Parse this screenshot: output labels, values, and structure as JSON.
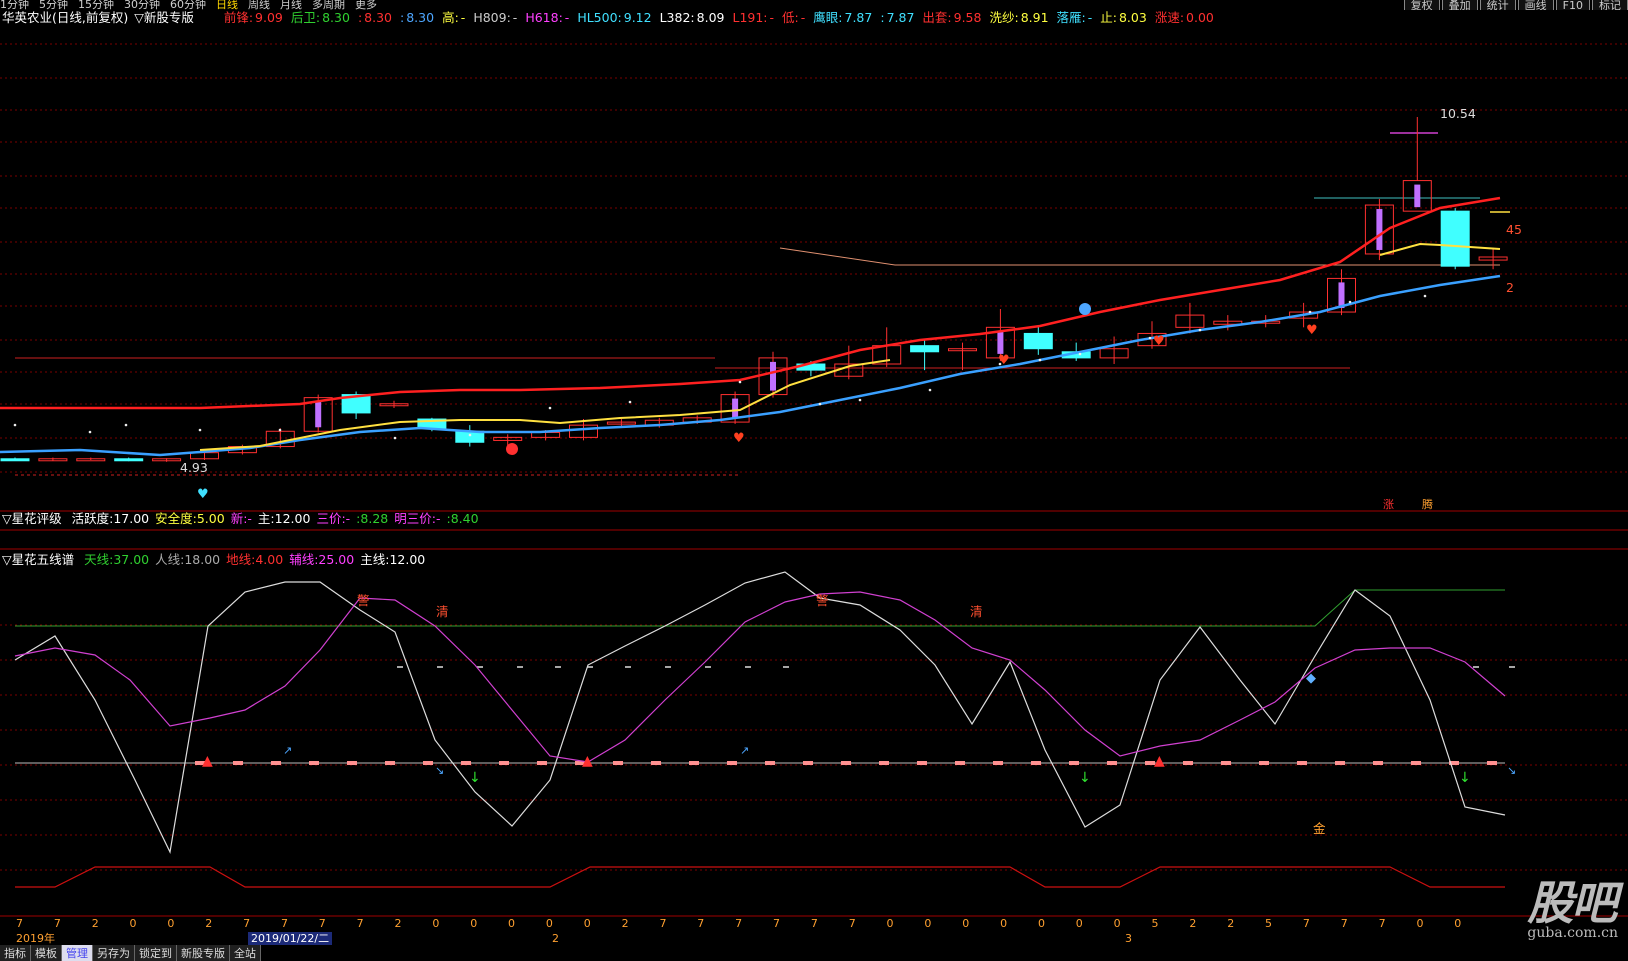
{
  "topbar": {
    "tabs": [
      "1分钟",
      "5分钟",
      "15分钟",
      "30分钟",
      "60分钟",
      "日线",
      "周线",
      "月线",
      "多周期",
      "更多"
    ],
    "active_tab": "日线",
    "buttons": [
      "复权",
      "叠加",
      "统计",
      "画线",
      "F10",
      "标记"
    ]
  },
  "header": {
    "title": "华英农业(日线,前复权)",
    "template": "▽新股专版",
    "items": [
      {
        "label": "前锋:",
        "value": "9.09",
        "color": "#ff3030"
      },
      {
        "label": "后卫:",
        "value": "8.30",
        "color": "#30d030"
      },
      {
        "label": ":",
        "value": "8.30",
        "color": "#ff3030"
      },
      {
        "label": ":",
        "value": "8.30",
        "color": "#4da6ff"
      },
      {
        "label": "高:",
        "value": "-",
        "color": "#ffff40"
      },
      {
        "label": "H809:",
        "value": "-",
        "color": "#cccccc"
      },
      {
        "label": "H618:",
        "value": "-",
        "color": "#ff40ff"
      },
      {
        "label": "HL500:",
        "value": "9.12",
        "color": "#40e0ff"
      },
      {
        "label": "L382:",
        "value": "8.09",
        "color": "#ffffff"
      },
      {
        "label": "L191:",
        "value": "-",
        "color": "#ff3030"
      },
      {
        "label": "低:",
        "value": "-",
        "color": "#ff3030"
      },
      {
        "label": "鹰眼:",
        "value": "7.87",
        "color": "#40e0ff"
      },
      {
        "label": ":",
        "value": "7.87",
        "color": "#40e0ff"
      },
      {
        "label": "出套:",
        "value": "9.58",
        "color": "#ff3030"
      },
      {
        "label": "洗纱:",
        "value": "8.91",
        "color": "#ffff40"
      },
      {
        "label": "落雁:",
        "value": "-",
        "color": "#40e0ff"
      },
      {
        "label": "止:",
        "value": "8.03",
        "color": "#ffff40"
      },
      {
        "label": "涨速:",
        "value": "0.00",
        "color": "#ff3030"
      }
    ]
  },
  "price_labels": {
    "high": "10.54",
    "low": "4.93",
    "right_top": "45",
    "right_bottom": "2"
  },
  "price_markers": {
    "zhang": "涨",
    "teng": "腾"
  },
  "ind1": {
    "title": "▽星花评级",
    "items": [
      {
        "label": "活跃度:",
        "value": "17.00",
        "color": "#ffffff"
      },
      {
        "label": "安全度:",
        "value": "5.00",
        "color": "#ffff40"
      },
      {
        "label": "新:",
        "value": "-",
        "color": "#ff40ff"
      },
      {
        "label": "主:",
        "value": "12.00",
        "color": "#ffffff"
      },
      {
        "label": "三价:",
        "value": "-",
        "color": "#ff40ff"
      },
      {
        "label": ":",
        "value": "8.28",
        "color": "#30d030"
      },
      {
        "label": "明三价:",
        "value": "-",
        "color": "#ff40ff"
      },
      {
        "label": ":",
        "value": "8.40",
        "color": "#30d030"
      }
    ]
  },
  "ind2": {
    "title": "▽星花五线谱",
    "items": [
      {
        "label": "天线:",
        "value": "37.00",
        "color": "#30d030"
      },
      {
        "label": "人线:",
        "value": "18.00",
        "color": "#aaaaaa"
      },
      {
        "label": "地线:",
        "value": "4.00",
        "color": "#ff3030"
      },
      {
        "label": "辅线:",
        "value": "25.00",
        "color": "#ff40ff"
      },
      {
        "label": "主线:",
        "value": "12.00",
        "color": "#ffffff"
      }
    ],
    "signals": {
      "jing": "警",
      "qing": "清",
      "jin": "金"
    }
  },
  "xaxis_values": [
    "7",
    "7",
    "2",
    "0",
    "0",
    "2",
    "7",
    "7",
    "7",
    "7",
    "2",
    "0",
    "0",
    "0",
    "0",
    "0",
    "2",
    "7",
    "7",
    "7",
    "7",
    "7",
    "7",
    "0",
    "0",
    "0",
    "0",
    "0",
    "0",
    "0",
    "5",
    "2",
    "2",
    "5",
    "7",
    "7",
    "7",
    "0",
    "0"
  ],
  "statusbar": {
    "year": "2019年",
    "date": "2019/01/22/二",
    "month2": "2",
    "month3": "3",
    "tabs": [
      "指标",
      "模板",
      "管理",
      "另存为",
      "锁定到",
      "新股专版",
      "全站"
    ],
    "active_tab": "管理"
  },
  "watermark": {
    "big": "股吧",
    "small": "guba.com.cn"
  },
  "colors": {
    "up": "#ff3030",
    "down": "#40ffff",
    "ma_red": "#ff2020",
    "ma_blue": "#3aa0ff",
    "ma_yellow": "#ffe040",
    "grid": "#7a0000"
  },
  "chart_data": {
    "type": "candlestick",
    "candles": [
      [
        4.95,
        4.93,
        4.97,
        4.92
      ],
      [
        4.94,
        4.95,
        4.97,
        4.92
      ],
      [
        4.95,
        4.95,
        4.97,
        4.93
      ],
      [
        4.95,
        4.92,
        4.97,
        4.91
      ],
      [
        4.92,
        4.95,
        4.96,
        4.9
      ],
      [
        4.95,
        5.05,
        5.07,
        4.93
      ],
      [
        5.05,
        5.15,
        5.18,
        5.02
      ],
      [
        5.15,
        5.4,
        5.45,
        5.12
      ],
      [
        5.4,
        5.95,
        6.0,
        5.38
      ],
      [
        6.0,
        5.7,
        6.05,
        5.6
      ],
      [
        5.85,
        5.85,
        5.9,
        5.78
      ],
      [
        5.6,
        5.45,
        5.62,
        5.4
      ],
      [
        5.4,
        5.22,
        5.5,
        5.15
      ],
      [
        5.25,
        5.3,
        5.35,
        5.1
      ],
      [
        5.3,
        5.38,
        5.42,
        5.25
      ],
      [
        5.3,
        5.5,
        5.6,
        5.25
      ],
      [
        5.55,
        5.55,
        5.6,
        5.48
      ],
      [
        5.5,
        5.58,
        5.62,
        5.46
      ],
      [
        5.55,
        5.62,
        5.66,
        5.52
      ],
      [
        5.55,
        6.0,
        6.05,
        5.52
      ],
      [
        6.0,
        6.6,
        6.7,
        5.95
      ],
      [
        6.5,
        6.4,
        6.55,
        6.3
      ],
      [
        6.3,
        6.5,
        6.8,
        6.25
      ],
      [
        6.5,
        6.8,
        7.1,
        6.45
      ],
      [
        6.8,
        6.7,
        6.9,
        6.4
      ],
      [
        6.75,
        6.75,
        6.85,
        6.4
      ],
      [
        6.6,
        7.1,
        7.4,
        6.55
      ],
      [
        7.0,
        6.75,
        7.1,
        6.65
      ],
      [
        6.7,
        6.6,
        6.85,
        6.55
      ],
      [
        6.6,
        6.75,
        6.95,
        6.5
      ],
      [
        6.8,
        7.0,
        7.2,
        6.75
      ],
      [
        7.1,
        7.3,
        7.5,
        7.0
      ],
      [
        7.15,
        7.2,
        7.3,
        7.05
      ],
      [
        7.2,
        7.2,
        7.3,
        7.1
      ],
      [
        7.25,
        7.35,
        7.5,
        7.1
      ],
      [
        7.35,
        7.9,
        8.05,
        7.3
      ],
      [
        8.3,
        9.1,
        9.2,
        8.2
      ],
      [
        9.0,
        9.5,
        10.54,
        9.5
      ],
      [
        9.0,
        8.1,
        9.05,
        8.05
      ],
      [
        8.2,
        8.25,
        8.4,
        8.05
      ]
    ]
  }
}
